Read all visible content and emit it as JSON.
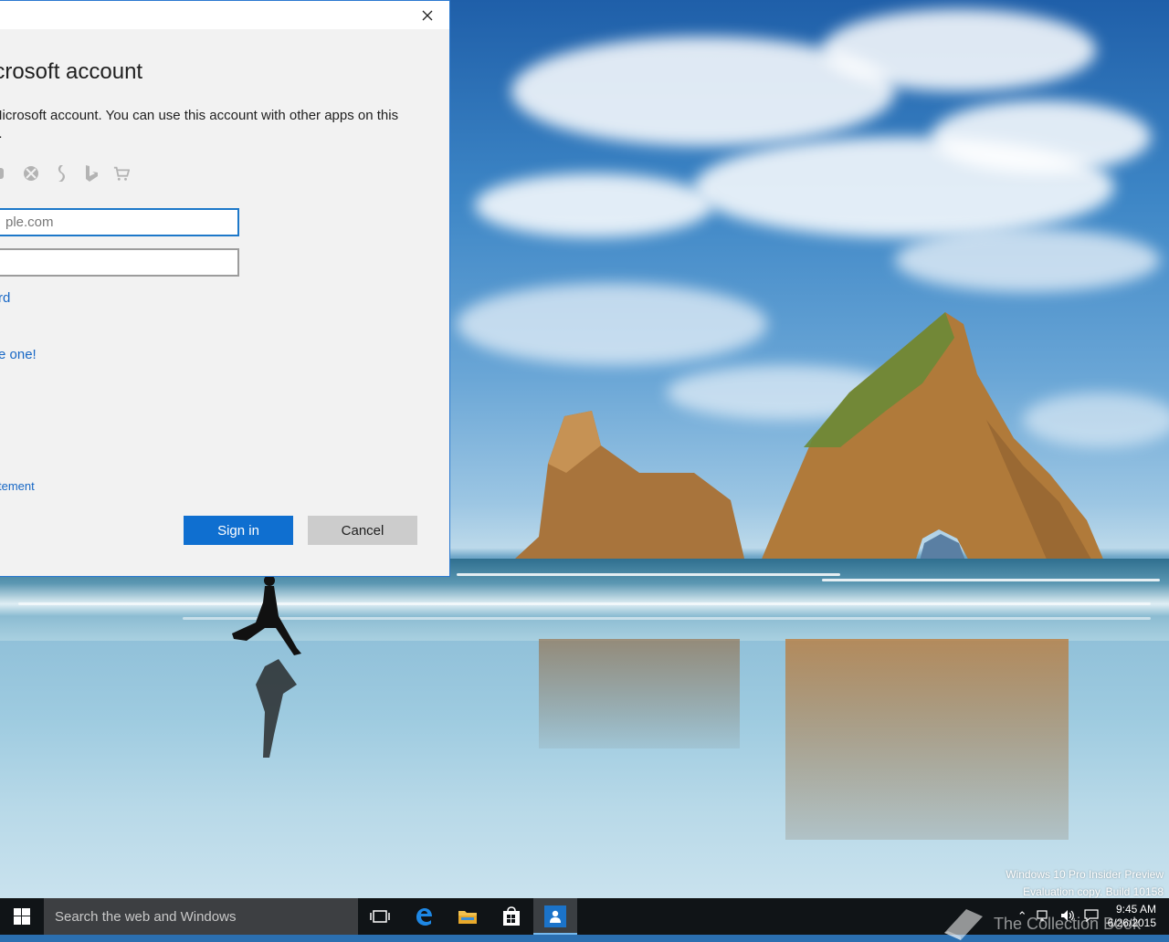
{
  "dialog": {
    "title": "icrosoft account",
    "description": "Microsoft account. You can use this account with other apps on this\ne.",
    "email_placeholder": "ple.com",
    "password_value": "",
    "forgot_link": "rd",
    "create_link": "e one!",
    "privacy_link": "tement",
    "signin_label": "Sign in",
    "cancel_label": "Cancel",
    "service_icons": [
      "outlook-icon",
      "xbox-icon",
      "skype-icon",
      "bing-icon",
      "store-icon"
    ]
  },
  "watermark": {
    "line1": "Windows 10 Pro Insider Preview",
    "line2": "Evaluation copy. Build 10158"
  },
  "taskbar": {
    "search_placeholder": "Search the web and Windows",
    "apps": [
      "task-view-icon",
      "edge-icon",
      "file-explorer-icon",
      "store-icon",
      "people-icon"
    ],
    "clock_time": "9:45 AM",
    "clock_date": "6/26/2015",
    "brand": "The Collection Book"
  },
  "colors": {
    "accent": "#0f6fd0",
    "link": "#1767c5",
    "taskbar": "#101417"
  }
}
